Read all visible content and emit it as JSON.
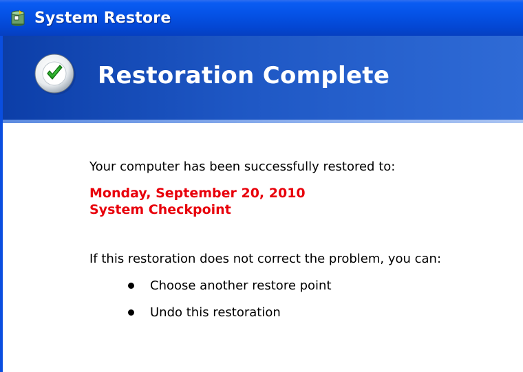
{
  "window": {
    "title": "System Restore",
    "icon": "system-restore-icon"
  },
  "header": {
    "title": "Restoration Complete",
    "icon": "checkmark-icon",
    "accent_color": "#1e57c4"
  },
  "content": {
    "intro": "Your computer has been successfully restored to:",
    "restore_point": {
      "date": "Monday, September 20, 2010",
      "description": "System Checkpoint",
      "color": "#e8000b"
    },
    "options_intro": "If this restoration does not correct the problem, you can:",
    "options": [
      {
        "label": "Choose another restore point"
      },
      {
        "label": "Undo this restoration"
      }
    ]
  }
}
